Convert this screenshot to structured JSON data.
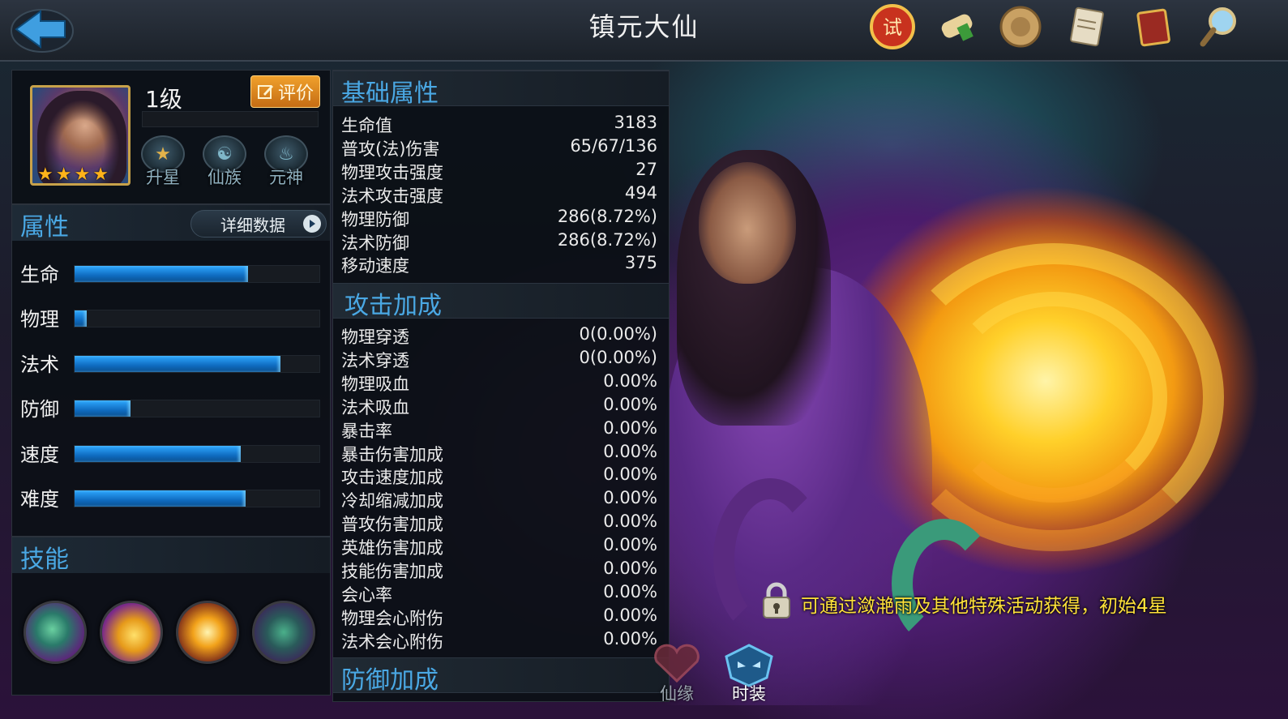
{
  "window": {
    "title": "镇元大仙"
  },
  "topbar_icons": [
    "trial-seal-icon",
    "scroll-icon",
    "coin-icon",
    "paper-icon",
    "book-icon",
    "magnifier-icon"
  ],
  "hero": {
    "level": "1级",
    "rate_label": "评价",
    "stars": 4,
    "actions": [
      {
        "label": "升星",
        "icon": "star-icon"
      },
      {
        "label": "仙族",
        "icon": "yin-yang-icon"
      },
      {
        "label": "元神",
        "icon": "spirit-flame-icon"
      }
    ]
  },
  "attributes_section": {
    "title": "属性",
    "detail_button": "详细数据",
    "bars": [
      {
        "label": "生命",
        "value": 0.71
      },
      {
        "label": "物理",
        "value": 0.05
      },
      {
        "label": "法术",
        "value": 0.84
      },
      {
        "label": "防御",
        "value": 0.23
      },
      {
        "label": "速度",
        "value": 0.68
      },
      {
        "label": "难度",
        "value": 0.7
      }
    ]
  },
  "skills_section": {
    "title": "技能",
    "skills": [
      "skill-1-icon",
      "skill-2-icon",
      "skill-3-icon",
      "skill-4-icon"
    ]
  },
  "basic": {
    "title": "基础属性",
    "rows": [
      {
        "k": "生命值",
        "v": "3183"
      },
      {
        "k": "普攻(法)伤害",
        "v": "65/67/136"
      },
      {
        "k": "物理攻击强度",
        "v": "27"
      },
      {
        "k": "法术攻击强度",
        "v": "494"
      },
      {
        "k": "物理防御",
        "v": "286(8.72%)"
      },
      {
        "k": "法术防御",
        "v": "286(8.72%)"
      },
      {
        "k": "移动速度",
        "v": "375"
      }
    ]
  },
  "attack": {
    "title": "攻击加成",
    "rows": [
      {
        "k": "物理穿透",
        "v": "0(0.00%)"
      },
      {
        "k": "法术穿透",
        "v": "0(0.00%)"
      },
      {
        "k": "物理吸血",
        "v": "0.00%"
      },
      {
        "k": "法术吸血",
        "v": "0.00%"
      },
      {
        "k": "暴击率",
        "v": "0.00%"
      },
      {
        "k": "暴击伤害加成",
        "v": "0.00%"
      },
      {
        "k": "攻击速度加成",
        "v": "0.00%"
      },
      {
        "k": "冷却缩减加成",
        "v": "0.00%"
      },
      {
        "k": "普攻伤害加成",
        "v": "0.00%"
      },
      {
        "k": "英雄伤害加成",
        "v": "0.00%"
      },
      {
        "k": "技能伤害加成",
        "v": "0.00%"
      },
      {
        "k": "会心率",
        "v": "0.00%"
      },
      {
        "k": "物理会心附伤",
        "v": "0.00%"
      },
      {
        "k": "法术会心附伤",
        "v": "0.00%"
      }
    ]
  },
  "defense": {
    "title": "防御加成"
  },
  "acquire_info": "可通过潋滟雨及其他特殊活动获得，初始4星",
  "bottom_tabs": [
    {
      "label": "仙缘",
      "icon": "heart-icon"
    },
    {
      "label": "时装",
      "icon": "costume-mask-icon"
    }
  ],
  "colors": {
    "accent": "#4aa8e4",
    "bar": "#1f8fe6",
    "gold": "#ffb31a",
    "info": "#ffe23a"
  }
}
